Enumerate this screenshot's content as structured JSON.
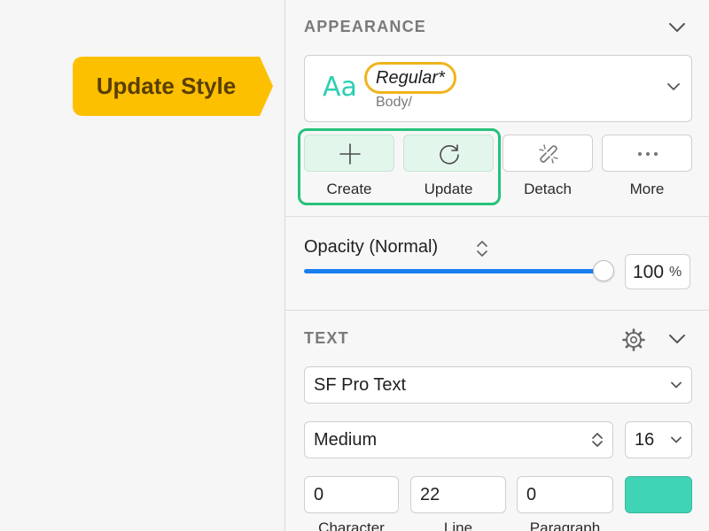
{
  "callout": {
    "label": "Update Style",
    "color": "#fcc000"
  },
  "appearance": {
    "title": "APPEARANCE",
    "style_preview": "Aa",
    "style_name": "Regular*",
    "style_path": "Body/",
    "actions": [
      {
        "label": "Create",
        "icon": "plus-icon"
      },
      {
        "label": "Update",
        "icon": "refresh-icon"
      },
      {
        "label": "Detach",
        "icon": "unlink-icon"
      },
      {
        "label": "More",
        "icon": "more-icon"
      }
    ],
    "highlight_color": "#26c27a"
  },
  "opacity": {
    "label": "Opacity (Normal)",
    "value": "100",
    "unit": "%",
    "level": 1.0
  },
  "text": {
    "title": "TEXT",
    "font_family": "SF Pro Text",
    "font_weight": "Medium",
    "font_size": "16",
    "character": "0",
    "line": "22",
    "paragraph": "0",
    "labels": {
      "character": "Character",
      "line": "Line",
      "paragraph": "Paragraph"
    },
    "color": "#40d4b6"
  }
}
